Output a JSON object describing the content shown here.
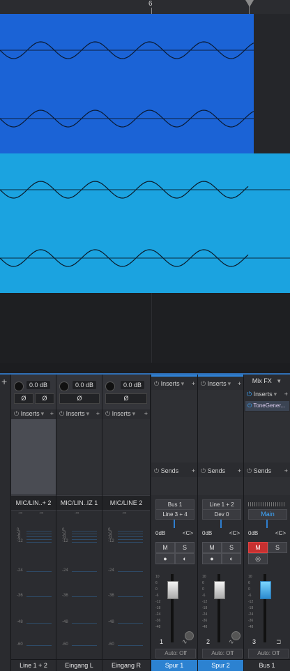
{
  "ruler": {
    "bar_label": "6"
  },
  "mixer": {
    "add_label": "+",
    "input_strips": [
      {
        "gain": "0.0 dB",
        "phase": [
          "Ø",
          "Ø"
        ],
        "inserts": "Inserts",
        "name": "MIC/LIN..+ 2",
        "label": "Line 1 + 2",
        "meter_top": [
          "-∞",
          "-∞"
        ],
        "scale": [
          "0",
          "-3",
          "-6",
          "-9",
          "-12",
          "-24",
          "-36",
          "-48",
          "-60"
        ]
      },
      {
        "gain": "0.0 dB",
        "phase": [
          "Ø"
        ],
        "inserts": "Inserts",
        "name": "MIC/LIN..IZ 1",
        "label": "Eingang L",
        "meter_top": [
          "-∞"
        ],
        "scale": [
          "0",
          "-3",
          "-6",
          "-9",
          "-12",
          "-24",
          "-36",
          "-48",
          "-60"
        ]
      },
      {
        "gain": "0.0 dB",
        "phase": [
          "Ø"
        ],
        "inserts": "Inserts",
        "name": "MIC/LINE 2",
        "label": "Eingang R",
        "meter_top": [
          "-∞"
        ],
        "scale": [
          "0",
          "-3",
          "-6",
          "-9",
          "-12",
          "-24",
          "-36",
          "-48",
          "-60"
        ]
      }
    ],
    "channels": [
      {
        "inserts": "Inserts",
        "sends": "Sends",
        "route_out": "Bus 1",
        "route_in": "Line 3 + 4",
        "volume": "0dB",
        "pan": "<C>",
        "mute": "M",
        "solo": "S",
        "number": "1",
        "automation": "Auto: Off",
        "label": "Spur 1"
      },
      {
        "inserts": "Inserts",
        "sends": "Sends",
        "route_out": "Line 1 + 2",
        "route_in": "Dev 0",
        "volume": "0dB",
        "pan": "<C>",
        "mute": "M",
        "solo": "S",
        "number": "2",
        "automation": "Auto: Off",
        "label": "Spur 2"
      },
      {
        "mixfx": "Mix FX",
        "inserts": "Inserts",
        "insert_item": "ToneGener...",
        "sends": "Sends",
        "route_out": "Main",
        "volume": "0dB",
        "pan": "<C>",
        "mute": "M",
        "solo": "S",
        "number": "3",
        "automation": "Auto: Off",
        "label": "Bus 1"
      }
    ],
    "fader_scale": [
      "10",
      "6",
      "0",
      "-6",
      "-12",
      "-18",
      "-24",
      "-36",
      "-48"
    ],
    "colors": {
      "accent": "#2f7fd0",
      "clip1": "#1b63d6",
      "clip2": "#1ba3e0",
      "mute_active": "#c73030"
    }
  }
}
